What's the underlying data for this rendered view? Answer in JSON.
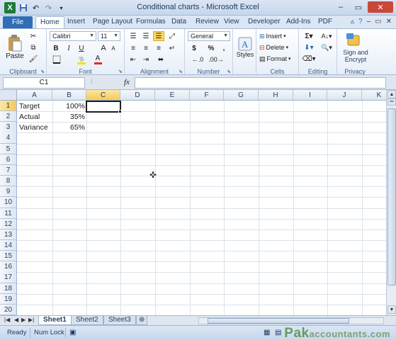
{
  "window": {
    "title": "Conditional charts - Microsoft Excel",
    "controls": [
      "–",
      "▭",
      "✕"
    ]
  },
  "qat": {
    "logo": "X",
    "icons": [
      "save-icon",
      "undo-icon",
      "redo-icon",
      "customize-icon"
    ]
  },
  "ribbon": {
    "file_label": "File",
    "tabs": [
      "Home",
      "Insert",
      "Page Layout",
      "Formulas",
      "Data",
      "Review",
      "View",
      "Developer",
      "Add-Ins",
      "PDF"
    ],
    "active_tab": "Home",
    "clipboard": {
      "label": "Clipboard",
      "paste": "Paste"
    },
    "font": {
      "label": "Font",
      "name": "Calibri",
      "size": "11",
      "bold": "B",
      "italic": "I",
      "underline": "U",
      "grow": "A",
      "shrink": "A"
    },
    "alignment": {
      "label": "Alignment"
    },
    "number": {
      "label": "Number",
      "format": "General",
      "currency": "$",
      "percent": "%",
      "comma": ","
    },
    "styles": {
      "label": "Styles"
    },
    "cells": {
      "label": "Cells",
      "insert": "Insert",
      "delete": "Delete",
      "format": "Format"
    },
    "editing": {
      "label": "Editing"
    },
    "privacy": {
      "label": "Privacy",
      "sign": "Sign and",
      "encrypt": "Encrypt"
    }
  },
  "formula_bar": {
    "name_box": "C1",
    "fx": "fx",
    "content": ""
  },
  "grid": {
    "columns": [
      "A",
      "B",
      "C",
      "D",
      "E",
      "F",
      "G",
      "H",
      "I",
      "J",
      "K"
    ],
    "rows": [
      "1",
      "2",
      "3",
      "4",
      "5",
      "6",
      "7",
      "8",
      "9",
      "10",
      "11",
      "12",
      "13",
      "14",
      "15",
      "16",
      "17",
      "18",
      "19",
      "20"
    ],
    "selected_column": "C",
    "selected_row": "1",
    "cells": [
      {
        "label": "Target",
        "value": "100%"
      },
      {
        "label": "Actual",
        "value": "35%"
      },
      {
        "label": "Variance",
        "value": "65%"
      }
    ]
  },
  "sheets": [
    "Sheet1",
    "Sheet2",
    "Sheet3"
  ],
  "active_sheet": "Sheet1",
  "status": {
    "ready": "Ready",
    "num_lock": "Num Lock"
  },
  "watermark": {
    "main": "Pak",
    "tail": "accountants.com"
  }
}
